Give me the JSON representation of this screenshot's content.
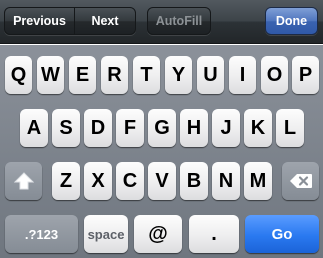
{
  "toolbar": {
    "previous_label": "Previous",
    "next_label": "Next",
    "autofill_label": "AutoFill",
    "done_label": "Done"
  },
  "keyboard": {
    "row1": [
      "Q",
      "W",
      "E",
      "R",
      "T",
      "Y",
      "U",
      "I",
      "O",
      "P"
    ],
    "row2": [
      "A",
      "S",
      "D",
      "F",
      "G",
      "H",
      "J",
      "K",
      "L"
    ],
    "row3": [
      "Z",
      "X",
      "C",
      "V",
      "B",
      "N",
      "M"
    ],
    "numbers_label": ".?123",
    "space_label": "space",
    "at_label": "@",
    "dot_label": ".",
    "go_label": "Go",
    "shift_icon": "shift-arrow-icon",
    "delete_icon": "backspace-icon"
  },
  "colors": {
    "toolbar_dark": "#2c3236",
    "done_blue": "#3a63b1",
    "keyboard_bg": "#7b828b",
    "go_blue": "#2a79f0"
  }
}
